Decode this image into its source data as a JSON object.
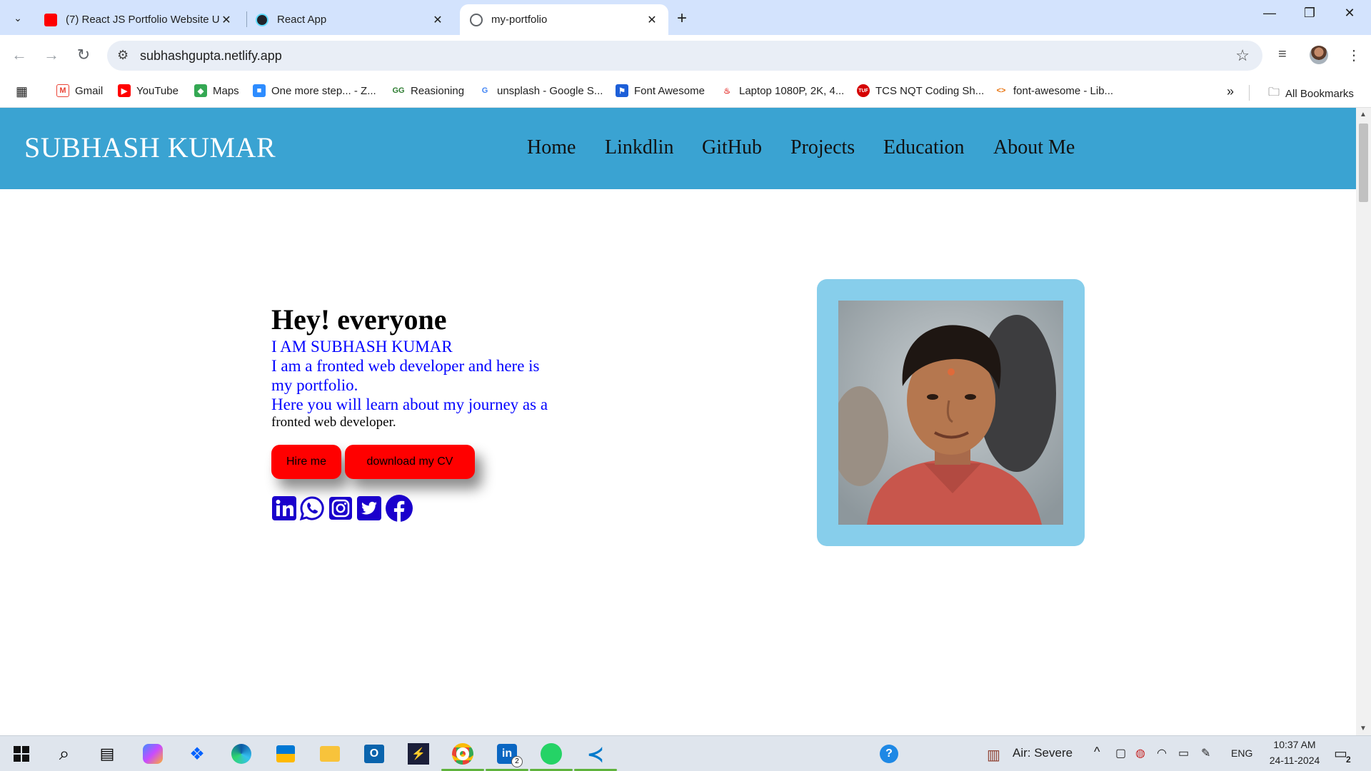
{
  "browser": {
    "tabs": [
      {
        "title": "(7) React JS Portfolio Website U",
        "active": false
      },
      {
        "title": "React App",
        "active": false
      },
      {
        "title": "my-portfolio",
        "active": true
      }
    ],
    "url": "subhashgupta.netlify.app",
    "bookmarks": [
      "Gmail",
      "YouTube",
      "Maps",
      "One more step... - Z...",
      "Reasioning",
      "unsplash - Google S...",
      "Font Awesome",
      "Laptop 1080P, 2K, 4...",
      "TCS NQT Coding Sh...",
      "font-awesome - Lib..."
    ],
    "all_bookmarks": "All Bookmarks"
  },
  "site": {
    "brand": "SUBHASH KUMAR",
    "nav": [
      "Home",
      "Linkdlin",
      "GitHub",
      "Projects",
      "Education",
      "About Me"
    ],
    "hero": {
      "greeting": "Hey! everyone",
      "line1": "I AM SUBHASH KUMAR",
      "line2": "I am a fronted web developer and here is",
      "line3": "my portfolio.",
      "line4": "Here you will learn about my journey as a",
      "line5": "fronted web developer.",
      "hire_button": "Hire me",
      "cv_button": "download my CV"
    },
    "social_icons": [
      "linkedin-icon",
      "whatsapp-icon",
      "instagram-icon",
      "twitter-icon",
      "facebook-icon"
    ],
    "colors": {
      "nav_bg": "#3aa3d2",
      "frame_bg": "#87ceeb",
      "button_bg": "#ff0000",
      "hero_text": "#0000ff"
    }
  },
  "taskbar": {
    "weather": "Air: Severe",
    "lang": "ENG",
    "time": "10:37 AM",
    "date": "24-11-2024",
    "notifications": "2",
    "linkedin_badge": "2"
  }
}
